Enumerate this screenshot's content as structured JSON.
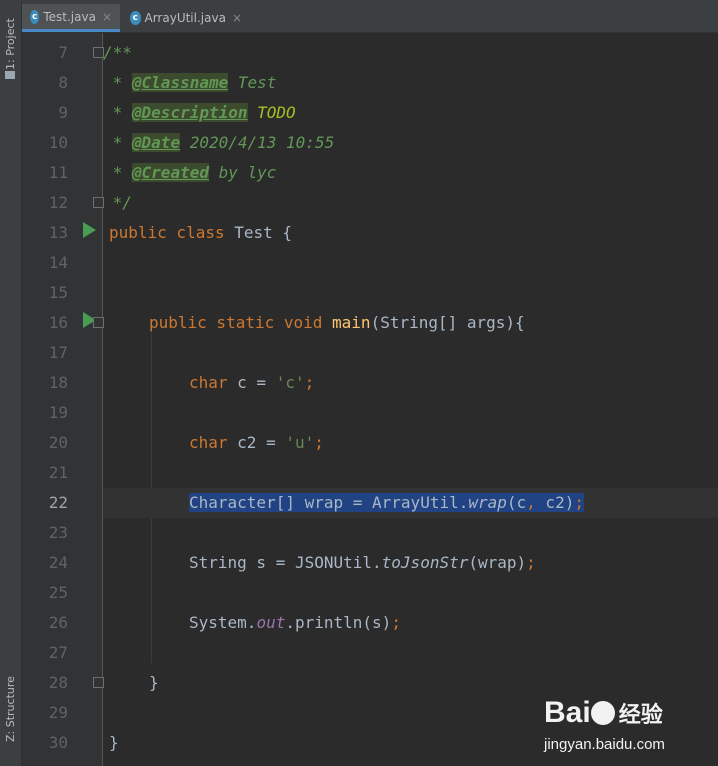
{
  "sidebar": {
    "project_label": "1: Project",
    "structure_label": "Z: Structure"
  },
  "tabs": [
    {
      "label": "Test.java",
      "icon": "c"
    },
    {
      "label": "ArrayUtil.java",
      "icon": "c"
    }
  ],
  "close_glyph": "×",
  "line_numbers": [
    "7",
    "8",
    "9",
    "10",
    "11",
    "12",
    "13",
    "14",
    "15",
    "16",
    "17",
    "18",
    "19",
    "20",
    "21",
    "22",
    "23",
    "24",
    "25",
    "26",
    "27",
    "28",
    "29",
    "30"
  ],
  "code": {
    "l7": "/**",
    "l8_star": " * ",
    "l8_tag": "@Classname",
    "l8_val": " Test",
    "l9_star": " * ",
    "l9_tag": "@Description",
    "l9_val": " TODO",
    "l10_star": " * ",
    "l10_tag": "@Date",
    "l10_val": " 2020/4/13 10:55",
    "l11_star": " * ",
    "l11_tag": "@Created",
    "l11_val": " by lyc",
    "l12": " */",
    "l13_kw": "public class",
    "l13_rest": " Test {",
    "l16_kw": "public static void",
    "l16_fn": "main",
    "l16_rest": "(String[] args){",
    "l18_kw": "char",
    "l18_mid": " c = ",
    "l18_str": "'c'",
    "l18_semi": ";",
    "l20_kw": "char",
    "l20_mid": " c2 = ",
    "l20_str": "'u'",
    "l20_semi": ";",
    "l22_a": "Character[] wrap = ArrayUtil.",
    "l22_m": "wrap",
    "l22_b": "(c",
    "l22_comma": ",",
    "l22_c": " c2)",
    "l22_semi": ";",
    "l24_a": "String s = JSONUtil.",
    "l24_m": "toJsonStr",
    "l24_b": "(wrap)",
    "l24_semi": ";",
    "l26_a": "System.",
    "l26_f": "out",
    "l26_b": ".println(s)",
    "l26_semi": ";",
    "l28": "}",
    "l30": "}"
  },
  "watermark": {
    "brand": "Bai",
    "brand_du": "du",
    "brand_cn": "经验",
    "url": "jingyan.baidu.com"
  }
}
